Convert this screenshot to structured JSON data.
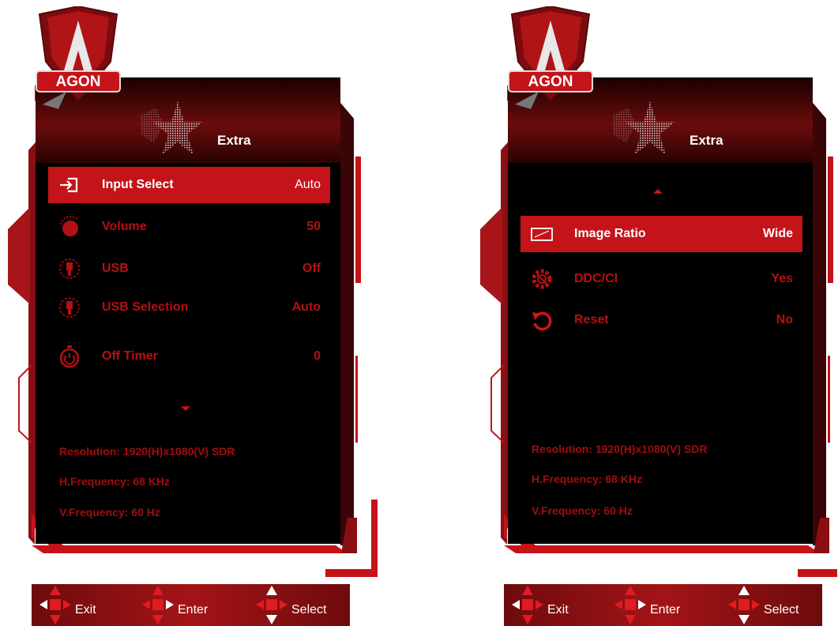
{
  "brand": {
    "logo_text": "AGON"
  },
  "colors": {
    "accent": "#c4141a",
    "dim_text": "#b51012",
    "panel": "#000000"
  },
  "left_panel": {
    "title": "Extra",
    "items": [
      {
        "icon": "input-select-icon",
        "label": "Input Select",
        "value": "Auto",
        "selected": true
      },
      {
        "icon": "volume-icon",
        "label": "Volume",
        "value": "50",
        "selected": false
      },
      {
        "icon": "usb-icon",
        "label": "USB",
        "value": "Off",
        "selected": false
      },
      {
        "icon": "usb-selection-icon",
        "label": "USB Selection",
        "value": "Auto",
        "selected": false
      },
      {
        "icon": "timer-icon",
        "label": "Off Timer",
        "value": "0",
        "selected": false
      }
    ],
    "scroll_indicator": "down",
    "info": {
      "resolution": "Resolution: 1920(H)x1080(V) SDR",
      "h_frequency": "H.Frequency: 68 KHz",
      "v_frequency": "V.Frequency: 60 Hz"
    },
    "footer": {
      "exit": "Exit",
      "enter": "Enter",
      "select": "Select"
    }
  },
  "right_panel": {
    "title": "Extra",
    "scroll_indicator": "up",
    "items": [
      {
        "icon": "image-ratio-icon",
        "label": "Image Ratio",
        "value": "Wide",
        "selected": true
      },
      {
        "icon": "ddc-ci-icon",
        "label": "DDC/CI",
        "value": "Yes",
        "selected": false
      },
      {
        "icon": "reset-icon",
        "label": "Reset",
        "value": "No",
        "selected": false
      }
    ],
    "info": {
      "resolution": "Resolution: 1920(H)x1080(V) SDR",
      "h_frequency": "H.Frequency: 68 KHz",
      "v_frequency": "V.Frequency: 60 Hz"
    },
    "footer": {
      "exit": "Exit",
      "enter": "Enter",
      "select": "Select"
    }
  }
}
